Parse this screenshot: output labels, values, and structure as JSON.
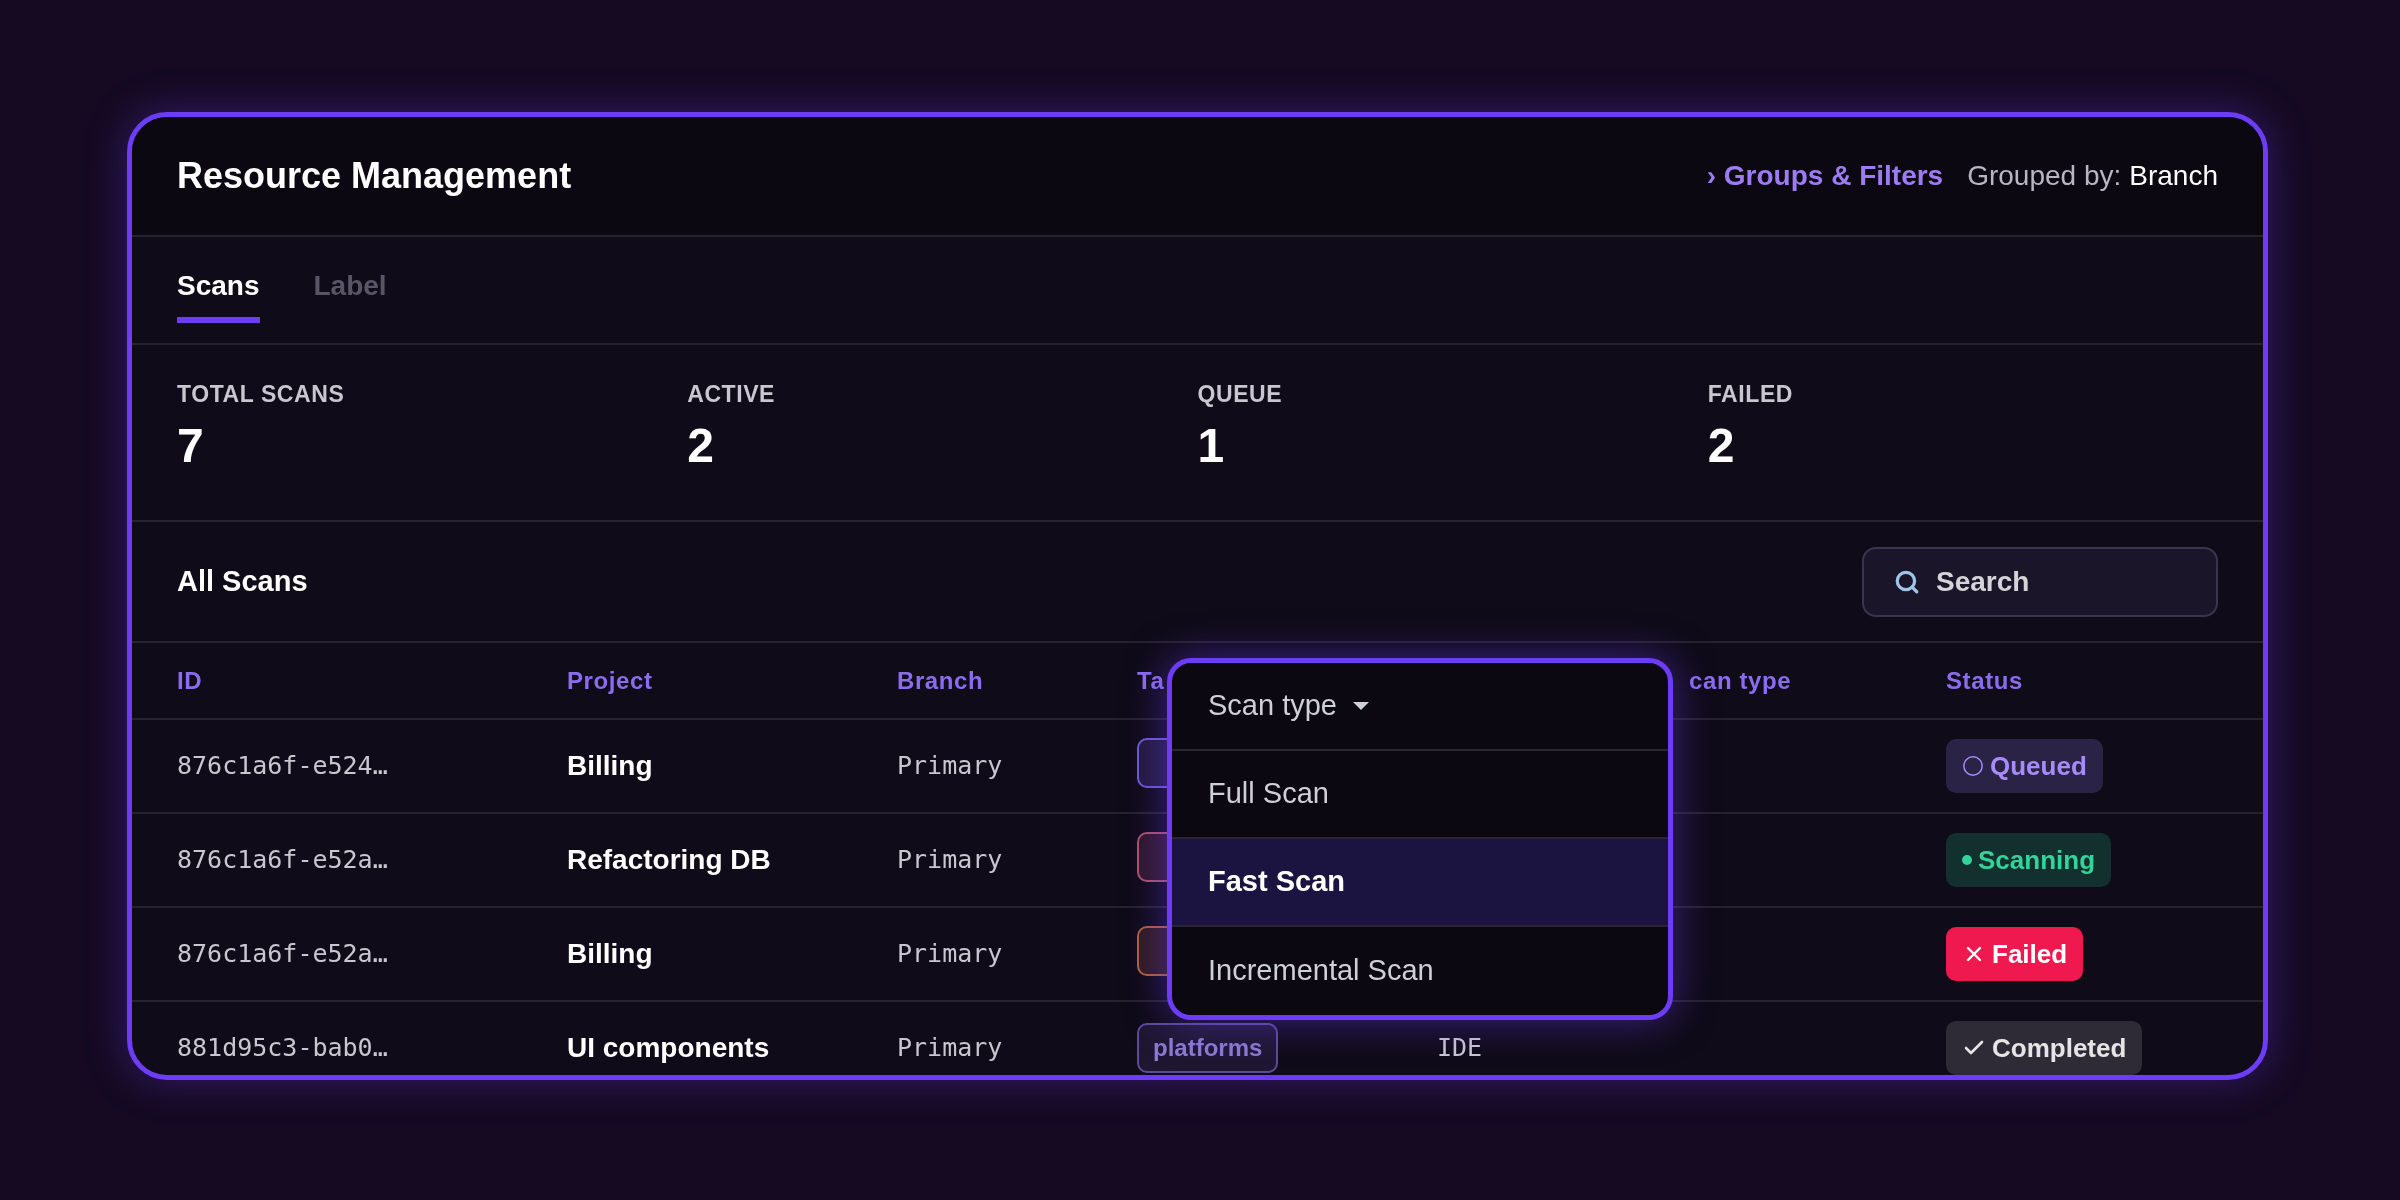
{
  "header": {
    "title": "Resource Management",
    "filters_link": "› Groups & Filters",
    "grouped_by_label": "Grouped by:",
    "grouped_by_value": "Branch"
  },
  "tabs": [
    {
      "label": "Scans",
      "selected": true
    },
    {
      "label": "Label",
      "selected": false
    }
  ],
  "stats": [
    {
      "label": "TOTAL SCANS",
      "value": "7"
    },
    {
      "label": "ACTIVE",
      "value": "2"
    },
    {
      "label": "QUEUE",
      "value": "1"
    },
    {
      "label": "FAILED",
      "value": "2"
    }
  ],
  "section": {
    "title": "All Scans",
    "search": {
      "placeholder": "Search"
    }
  },
  "table": {
    "columns": [
      "ID",
      "Project",
      "Branch",
      "Ta",
      "can type",
      "Status"
    ],
    "rows": [
      {
        "id": "876c1a6f-e524…",
        "project": "Billing",
        "branch": "Primary",
        "tag": {
          "color": "#6d5bd0"
        },
        "status": {
          "kind": "queued",
          "label": "Queued"
        }
      },
      {
        "id": "876c1a6f-e52a…",
        "project": "Refactoring DB",
        "branch": "Primary",
        "tag": {
          "color": "#b0506e"
        },
        "status": {
          "kind": "scanning",
          "label": "Scanning"
        }
      },
      {
        "id": "876c1a6f-e52a…",
        "project": "Billing",
        "branch": "Primary",
        "tag": {
          "color": "#b0603a"
        },
        "status": {
          "kind": "failed",
          "label": "Failed"
        }
      },
      {
        "id": "881d95c3-bab0…",
        "project": "UI components",
        "branch": "Primary",
        "tag": {
          "color": "#5b4b9a",
          "label": "platforms"
        },
        "scan_type": "IDE",
        "status": {
          "kind": "completed",
          "label": "Completed"
        }
      }
    ]
  },
  "dropdown": {
    "label": "Scan type",
    "options": [
      {
        "label": "Full Scan",
        "selected": false
      },
      {
        "label": "Fast Scan",
        "selected": true
      },
      {
        "label": "Incremental Scan",
        "selected": false
      }
    ]
  }
}
